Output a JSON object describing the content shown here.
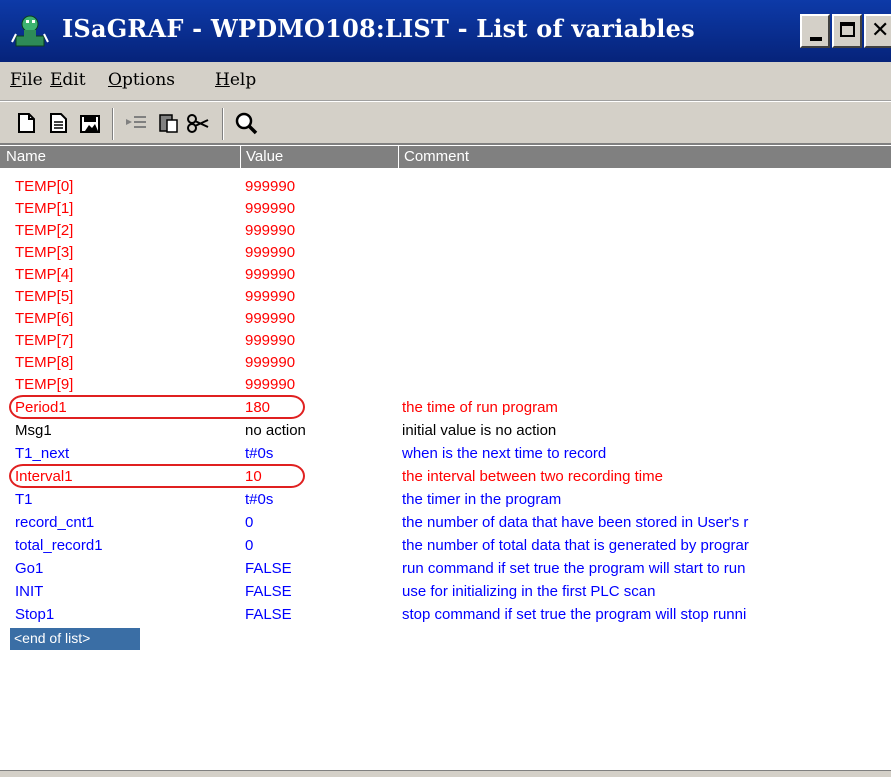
{
  "window": {
    "title": "ISaGRAF - WPDMO108:LIST - List of variables"
  },
  "menu": [
    {
      "accel": "F",
      "rest": "ile"
    },
    {
      "accel": "E",
      "rest": "dit"
    },
    {
      "accel": "O",
      "rest": "ptions"
    },
    {
      "accel": "H",
      "rest": "elp"
    }
  ],
  "toolbar": {
    "icons": [
      "new-icon",
      "open-icon",
      "save-icon",
      "insert-icon",
      "paste-icon",
      "cut-icon",
      "search-icon"
    ]
  },
  "columns": {
    "name": "Name",
    "value": "Value",
    "comment": "Comment"
  },
  "rows": [
    {
      "name": "TEMP[0]",
      "value": "999990",
      "comment": "",
      "color": "red"
    },
    {
      "name": "TEMP[1]",
      "value": "999990",
      "comment": "",
      "color": "red"
    },
    {
      "name": "TEMP[2]",
      "value": "999990",
      "comment": "",
      "color": "red"
    },
    {
      "name": "TEMP[3]",
      "value": "999990",
      "comment": "",
      "color": "red"
    },
    {
      "name": "TEMP[4]",
      "value": "999990",
      "comment": "",
      "color": "red"
    },
    {
      "name": "TEMP[5]",
      "value": "999990",
      "comment": "",
      "color": "red"
    },
    {
      "name": "TEMP[6]",
      "value": "999990",
      "comment": "",
      "color": "red"
    },
    {
      "name": "TEMP[7]",
      "value": "999990",
      "comment": "",
      "color": "red"
    },
    {
      "name": "TEMP[8]",
      "value": "999990",
      "comment": "",
      "color": "red"
    },
    {
      "name": "TEMP[9]",
      "value": "999990",
      "comment": "",
      "color": "red"
    },
    {
      "name": "Period1",
      "value": "180",
      "comment": "the time of run program",
      "color": "red"
    },
    {
      "name": "Msg1",
      "value": "no action",
      "comment": "initial value is no action",
      "color": "black"
    },
    {
      "name": "T1_next",
      "value": "t#0s",
      "comment": "when is the next time to record",
      "color": "blue"
    },
    {
      "name": "Interval1",
      "value": "10",
      "comment": "the interval between two recording time",
      "color": "red"
    },
    {
      "name": "T1",
      "value": "t#0s",
      "comment": "the timer in the program",
      "color": "blue"
    },
    {
      "name": "record_cnt1",
      "value": "0",
      "comment": "the number of data that have been stored in User's r",
      "color": "blue"
    },
    {
      "name": "total_record1",
      "value": "0",
      "comment": "the number of total data that is generated by prograr",
      "color": "blue"
    },
    {
      "name": "Go1",
      "value": "FALSE",
      "comment": "run command if set true the program will start to run",
      "color": "blue"
    },
    {
      "name": "INIT",
      "value": "FALSE",
      "comment": "use for initializing in the first PLC scan",
      "color": "blue"
    },
    {
      "name": "Stop1",
      "value": "FALSE",
      "comment": "stop command if set true the program will stop runni",
      "color": "blue"
    }
  ],
  "end_of_list": "<end of list>",
  "colors": {
    "titlebar": "#0a2a8e",
    "chrome": "#d4d0c8",
    "header": "#808080",
    "selection": "#3a6ea5",
    "red_text": "#ff0000",
    "blue_text": "#0000ff",
    "highlight_ring": "#e02020"
  }
}
